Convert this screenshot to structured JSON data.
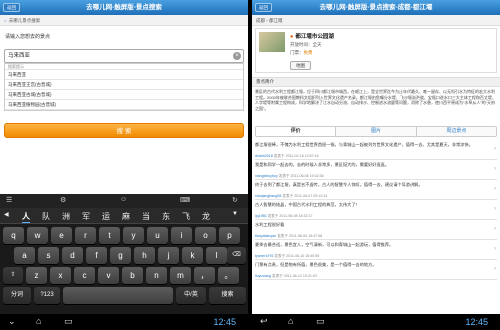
{
  "left": {
    "back_label": "返回",
    "title": "去哪儿网-触屏版-景点搜索",
    "breadcrumb": "去哪儿景点搜索",
    "prompt": "请输入您想去的景点",
    "search_value": "马来西亚",
    "suggest_header": "搜索提示",
    "suggestions": [
      "马来西亚",
      "马来西亚王宫(古晋城)",
      "马来西亚古城(古晋城)",
      "马来西亚植物园(古晋城)"
    ],
    "search_button": "搜 索"
  },
  "keyboard": {
    "candidates": [
      "人",
      "队",
      "洲",
      "军",
      "运",
      "麻",
      "当",
      "东",
      "飞",
      "龙"
    ],
    "rows": [
      [
        "q",
        "w",
        "e",
        "r",
        "t",
        "y",
        "u",
        "i",
        "o",
        "p"
      ],
      [
        "a",
        "s",
        "d",
        "f",
        "g",
        "h",
        "j",
        "k",
        "l"
      ],
      [
        "z",
        "x",
        "c",
        "v",
        "b",
        "n",
        "m",
        "，",
        "。"
      ]
    ],
    "mode_key": "?123",
    "lang_key": "中/英",
    "bottom_key_left": "分词",
    "enter_key": "搜索",
    "clock": "12:45"
  },
  "right": {
    "back_label": "返回",
    "title": "去哪儿网-触屏版-景点搜索-成都-都江堰",
    "breadcrumb": "成都 › 都江堰",
    "place_name": "都江堰市公园湖",
    "info": [
      {
        "label": "开放时间：",
        "value": "全天"
      },
      {
        "label": "门票：",
        "value": "免费"
      }
    ],
    "map_button": "地图",
    "section_title": "景点简介",
    "description": "景区的古代水利工程都江堰，位于四川都江堰市城西，在岷江上，是全世界迄今为止年代最久、唯一留存、以无坝引水为特征的宏大水利工程。2000年被联合国教科文组织列入世界文化遗产名录。都江堰由鱼嘴分水堤、飞沙堰溢洪道、宝瓶口进水口三大主体工程和百丈堤、人字堤等附属工程构成，科学地解决了江水自动分流、自动排沙、控制进水流量等问题，消除了水患，使川西平原成为“水旱从人”的“天府之国”。",
    "tabs": [
      "评价",
      "图片",
      "周边景点"
    ],
    "reviews": [
      {
        "text": "都江堰很棒，不愧为水利工程世界首屈一指，与青城山一起被列为世界文化遗产，值得一去，尤其是夏天，非常凉快。",
        "user": "dndsh2018",
        "date": "发表于 2011-02-16 12:57:16"
      },
      {
        "text": "我是和同学一起去的，去的时候人非常多，景区挺大的，需要好好逛逛。",
        "user": "xiangxiboyboy",
        "date": "发表于 2011-06-06 19:32:36"
      },
      {
        "text": "终于去到了都江堰，真是名不虚传，古人的智慧令人惊叹，值得一去，建议请个导游讲解。",
        "user": "nianjiangbang08",
        "date": "发表于 2011-06-07 09:12:34"
      },
      {
        "text": "古人智慧的结晶，中国古代水利工程的典范，太伟大了！",
        "user": "ljq1980",
        "date": "发表于 2011-06-08 18:32:17"
      },
      {
        "text": "水利工程很好看",
        "user": "tianyatianyan",
        "date": "发表于 2011-06-09 15:47:08"
      },
      {
        "text": "夏季去最合适，景色宜人，空气清新，可以和青城山一起游玩，值得推荐。",
        "user": "tywxer1976",
        "date": "发表于 2011-06-10 15:40:55"
      },
      {
        "text": "门票有点贵，但是物有所值，景色很美，是一个值得一去的地方。",
        "user": "liuyuxiang",
        "date": "发表于 2011-06-12 10:21:03"
      }
    ],
    "clock": "12:45"
  }
}
